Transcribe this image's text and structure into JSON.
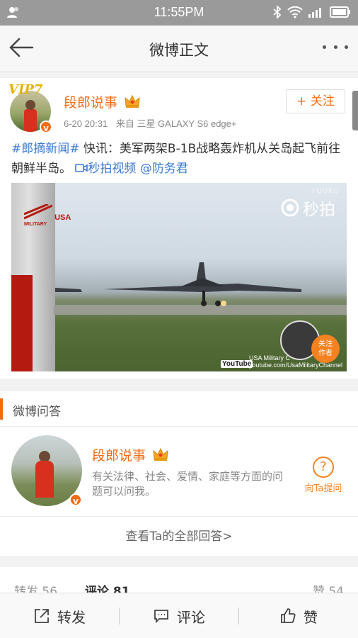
{
  "status_bar": {
    "time": "11:55PM"
  },
  "nav": {
    "title": "微博正文"
  },
  "post": {
    "username": "段郎说事",
    "avatar_badge": "VIP7",
    "timestamp": "6-20 20:31",
    "source_prefix": "来自",
    "source": "三星 GALAXY S6 edge+",
    "follow_label": "关注",
    "topic": "#郎摘新闻#",
    "text_main": " 快讯：美军两架B-1B战略轰炸机从关岛起飞前往朝鲜半岛。",
    "video_link": "秒拍视频",
    "mention": "@防务君",
    "video": {
      "watermark": "秒拍",
      "youku": "YOUKU",
      "channel_logo": "USA",
      "channel_logo_sub": "MILITARY",
      "yt_logo": "YouTube",
      "credit_line1": "USA Military C",
      "credit_line2": "youtube.com/UsaMilitaryChannel",
      "follow_author": "关注\n作者"
    }
  },
  "qa": {
    "section_title": "微博问答",
    "username": "段郎说事",
    "description": "有关法律、社会、爱情、家庭等方面的问题可以问我。",
    "ask_label": "向Ta提问",
    "view_all": "查看Ta的全部回答>"
  },
  "stats": {
    "repost_label": "转发",
    "repost_count": "56",
    "comment_label": "评论",
    "comment_count": "81",
    "like_label": "赞",
    "like_count": "54"
  },
  "bottom_bar": {
    "repost": "转发",
    "comment": "评论",
    "like": "赞"
  },
  "colors": {
    "accent": "#f26b11",
    "link": "#3c7ad0"
  }
}
